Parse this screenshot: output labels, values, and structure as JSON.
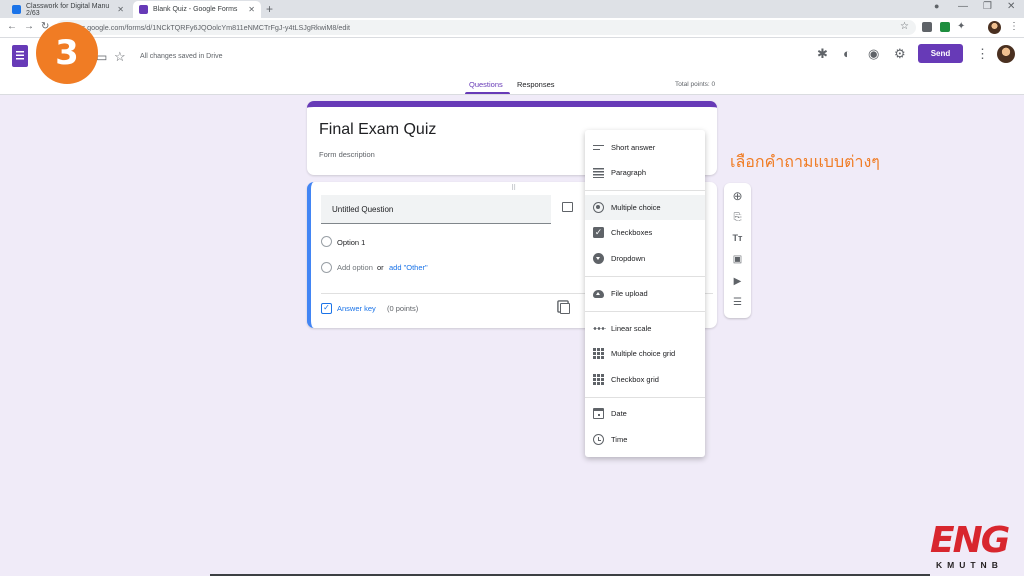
{
  "browser": {
    "tabs": [
      {
        "title": "Classwork for Digital Manu 2/63",
        "color": "#1a73e8"
      },
      {
        "title": "Blank Quiz - Google Forms",
        "color": "#673ab7"
      }
    ],
    "url": "docs.google.com/forms/d/1NCkTQRFy6JQOolcYm811eNMCTrFgJ-y4tLSJgRkwiM8/edit"
  },
  "header": {
    "step_number": "3",
    "save_status": "All changes saved in Drive",
    "send_label": "Send",
    "tabs": [
      {
        "label": "Questions",
        "selected": true
      },
      {
        "label": "Responses",
        "selected": false
      }
    ],
    "total_points": "Total points: 0"
  },
  "form": {
    "title": "Final Exam Quiz",
    "description_placeholder": "Form description"
  },
  "question": {
    "title": "Untitled Question",
    "option_1": "Option 1",
    "add_option": "Add option",
    "or_text": "or",
    "add_other": "add \"Other\"",
    "answer_key": "Answer key",
    "points": "(0 points)"
  },
  "type_menu": {
    "groups": [
      [
        {
          "label": "Short answer",
          "icon": "short-answer-icon"
        },
        {
          "label": "Paragraph",
          "icon": "paragraph-icon"
        }
      ],
      [
        {
          "label": "Multiple choice",
          "icon": "radio-icon",
          "selected": true
        },
        {
          "label": "Checkboxes",
          "icon": "checkbox-icon"
        },
        {
          "label": "Dropdown",
          "icon": "dropdown-icon"
        }
      ],
      [
        {
          "label": "File upload",
          "icon": "cloud-upload-icon"
        }
      ],
      [
        {
          "label": "Linear scale",
          "icon": "linear-scale-icon"
        },
        {
          "label": "Multiple choice grid",
          "icon": "grid-icon"
        },
        {
          "label": "Checkbox grid",
          "icon": "grid-icon"
        }
      ],
      [
        {
          "label": "Date",
          "icon": "calendar-icon"
        },
        {
          "label": "Time",
          "icon": "clock-icon"
        }
      ]
    ]
  },
  "annotation": "เลือกคำถามแบบต่างๆ",
  "watermark": {
    "logo": "ENG",
    "sub": "KMUTNB"
  },
  "colors": {
    "accent": "#673ab7",
    "link": "#1a73e8",
    "annotation": "#f07c24",
    "background": "#f0ebf8"
  }
}
